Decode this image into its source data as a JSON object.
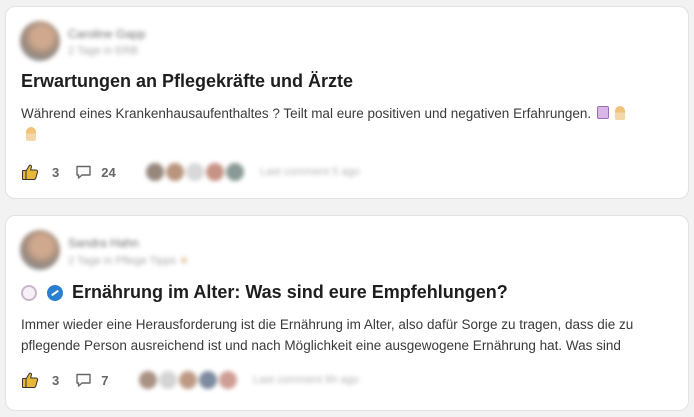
{
  "posts": [
    {
      "author": {
        "name": "Caroline Gapp",
        "meta": "2 Tage in ERB",
        "avatar_icon": "user-avatar"
      },
      "title": "Erwartungen an Pflegekräfte und Ärzte",
      "excerpt": "Während eines Krankenhausaufenthaltes ? Teilt mal eure positiven und negativen Erfahrungen.",
      "excerpt_emojis": [
        "hospital-emoji",
        "nurse-emoji",
        "nurse-emoji"
      ],
      "likes": "3",
      "comments": "24",
      "last_activity": "Last comment 5 ago"
    },
    {
      "author": {
        "name": "Sandra Hahn",
        "meta": "2 Tage in Pflege Tipps",
        "avatar_icon": "user-avatar"
      },
      "title_emojis": [
        "plate-emoji",
        "scale-emoji"
      ],
      "title": "Ernährung im Alter: Was sind eure Empfehlungen?",
      "excerpt": "Immer wieder eine Herausforderung ist die Ernährung im Alter, also dafür Sorge zu tragen, dass die zu pflegende Person ausreichend ist und nach Möglichkeit eine ausgewogene Ernährung hat. Was sind",
      "likes": "3",
      "comments": "7",
      "last_activity": "Last comment 6h ago"
    }
  ],
  "colors": {
    "background": "#f2f2f2",
    "card": "#ffffff",
    "title": "#1e1e1e",
    "like_icon": "#e8b73a",
    "muted": "#666666"
  },
  "icons": {
    "like": "thumbs-up-icon",
    "comment": "comment-bubble-icon"
  }
}
